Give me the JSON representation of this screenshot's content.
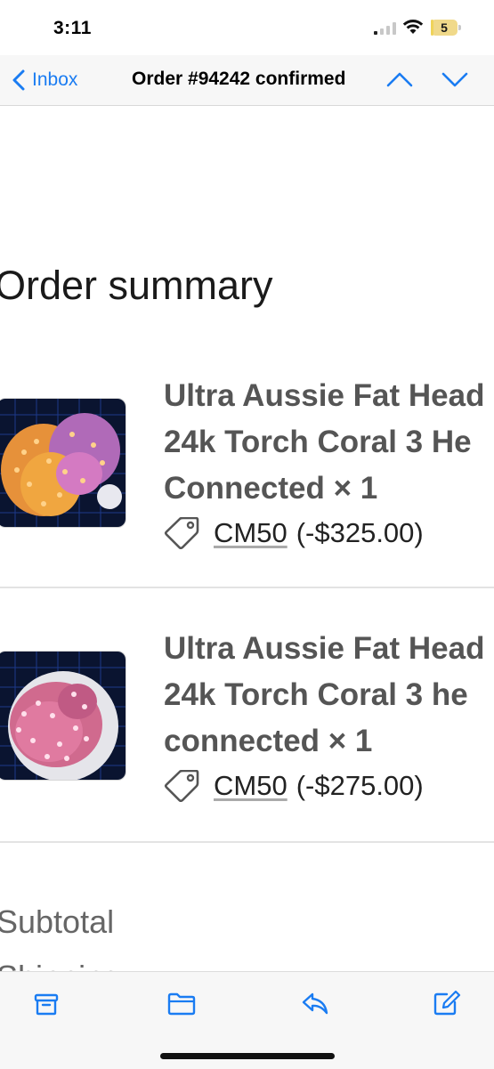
{
  "status_bar": {
    "time": "3:11",
    "battery_level": "5",
    "icons": [
      "signal-icon",
      "wifi-icon",
      "battery-icon"
    ]
  },
  "nav": {
    "back_label": "Inbox",
    "title": "Order #94242 confirmed",
    "icons": [
      "chevron-left-icon",
      "chevron-up-icon",
      "chevron-down-icon"
    ]
  },
  "email": {
    "section_title": "Order summary",
    "items": [
      {
        "name_lines": [
          "Ultra Aussie Fat Head",
          "24k Torch Coral 3 He",
          "Connected × 1"
        ],
        "discount_code": "CM50",
        "discount_amount": "(-$325.00)"
      },
      {
        "name_lines": [
          "Ultra Aussie Fat Head",
          "24k Torch Coral 3 he",
          "connected × 1"
        ],
        "discount_code": "CM50",
        "discount_amount": "(-$275.00)"
      }
    ],
    "subtotal_label": "Subtotal",
    "shipping_label": "Shipping"
  },
  "toolbar": {
    "icons": [
      "archive-icon",
      "folder-icon",
      "reply-icon",
      "compose-icon"
    ]
  },
  "colors": {
    "accent": "#1a7cf2",
    "battery": "#efd35a"
  }
}
